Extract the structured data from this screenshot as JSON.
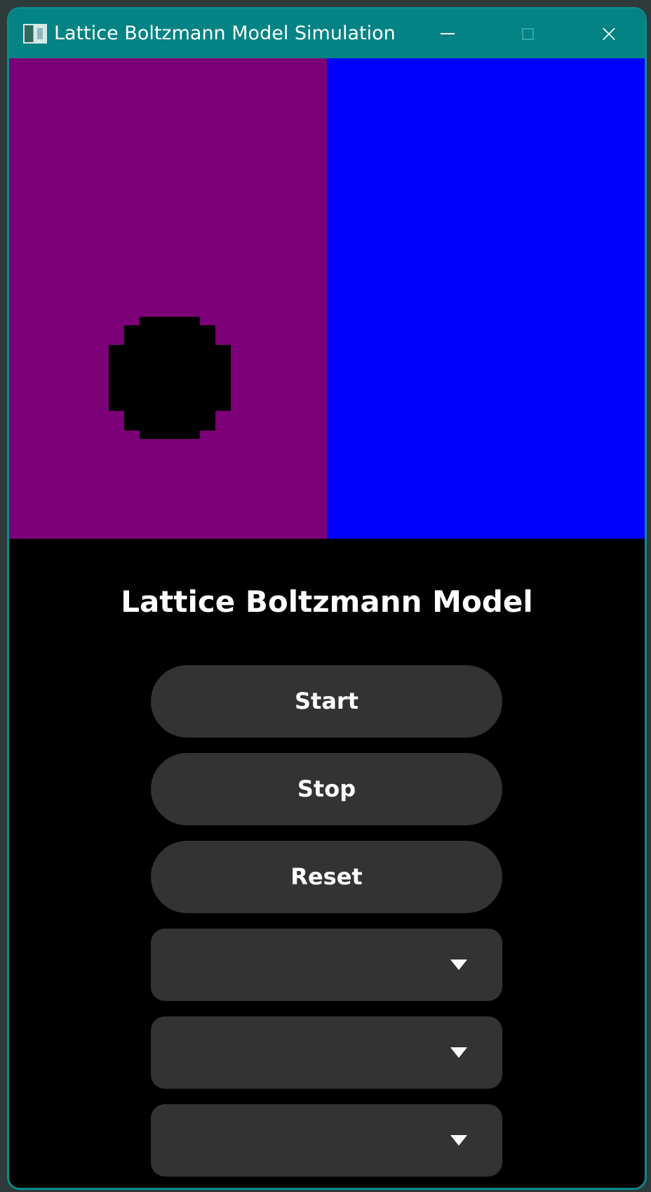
{
  "window": {
    "title": "Lattice Boltzmann Model Simulation",
    "icons": {
      "app": "app-window-icon",
      "minimize": "minimize-icon",
      "maximize": "maximize-icon",
      "close": "close-icon"
    },
    "accent_color": "#048384"
  },
  "simulation": {
    "left_region_color": "#7c0077",
    "right_region_color": "#0000ff",
    "obstacle_color": "#000000"
  },
  "panel": {
    "title": "Lattice Boltzmann Model",
    "buttons": {
      "start": "Start",
      "stop": "Stop",
      "reset": "Reset"
    },
    "dropdowns": [
      {
        "selected": "",
        "icon": "chevron-down-icon"
      },
      {
        "selected": "",
        "icon": "chevron-down-icon"
      },
      {
        "selected": "",
        "icon": "chevron-down-icon"
      }
    ]
  }
}
